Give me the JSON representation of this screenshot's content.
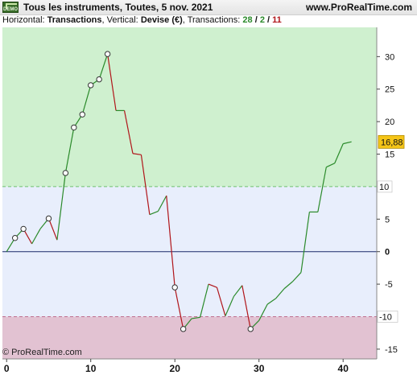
{
  "header": {
    "title": "Tous les instruments, Toutes, 5 nov. 2021",
    "site": "www.ProRealTime.com",
    "logo_text": "DEMO"
  },
  "subtitle": {
    "horizontal_label": "Horizontal:",
    "horizontal_value": "Transactions",
    "vertical_label": ", Vertical:",
    "vertical_value": "Devise (€)",
    "count_label": ", Transactions:",
    "total": "28",
    "sep1": "/",
    "wins": "2",
    "sep2": "/",
    "losses": "11"
  },
  "footer": {
    "copyright": "© ProRealTime.com"
  },
  "colors": {
    "positive_zone": "#cff0cf",
    "neutral_zone": "#e8eefc",
    "negative_zone": "#e2c2d2",
    "up_line": "#2a8a2a",
    "down_line": "#b0151a",
    "last_value_badge": "#f5c518"
  },
  "chart_data": {
    "type": "line",
    "xlim": [
      -0.5,
      44
    ],
    "ylim": [
      -16.5,
      34.5
    ],
    "x_ticks": [
      0,
      10,
      20,
      30,
      40
    ],
    "x_tick_labels": [
      "0",
      "10",
      "20",
      "30",
      "40"
    ],
    "y_ticks": [
      30,
      25,
      20,
      15,
      5,
      0,
      -5,
      -15
    ],
    "y_tick_labels": [
      "30",
      "25",
      "20",
      "15",
      "5",
      "0",
      "-5",
      "-15"
    ],
    "reference_lines": [
      {
        "value": 10,
        "label": "10",
        "style": "dashed"
      },
      {
        "value": 0,
        "label": "0",
        "style": "solid"
      },
      {
        "value": -10,
        "label": "-10",
        "style": "dashed"
      }
    ],
    "last_value_label": "16,88",
    "last_value": 16.88,
    "series": [
      {
        "x": [
          0,
          1,
          2,
          3,
          4,
          5,
          6,
          7,
          8,
          9,
          10,
          11,
          12,
          13,
          14,
          15,
          16,
          17,
          18,
          19,
          20,
          21,
          22,
          23,
          24,
          25,
          26,
          27,
          28,
          29,
          30,
          31,
          32,
          33,
          34,
          35,
          36,
          37,
          38,
          39,
          40,
          41
        ],
        "values": [
          0.0,
          2.1,
          3.5,
          1.2,
          3.5,
          5.1,
          1.8,
          12.1,
          19.1,
          21.1,
          25.6,
          26.5,
          30.4,
          21.7,
          21.7,
          15.1,
          14.9,
          5.7,
          6.2,
          8.6,
          -5.5,
          -11.9,
          -10.3,
          -10.1,
          -5.0,
          -5.5,
          -9.9,
          -6.9,
          -5.2,
          -11.9,
          -10.6,
          -8.1,
          -7.2,
          -5.7,
          -4.6,
          -3.2,
          6.1,
          6.1,
          13.0,
          13.6,
          16.6,
          16.9
        ]
      }
    ],
    "marked_points_x": [
      1,
      2,
      5,
      7,
      8,
      9,
      10,
      11,
      12,
      20,
      21,
      29
    ]
  }
}
